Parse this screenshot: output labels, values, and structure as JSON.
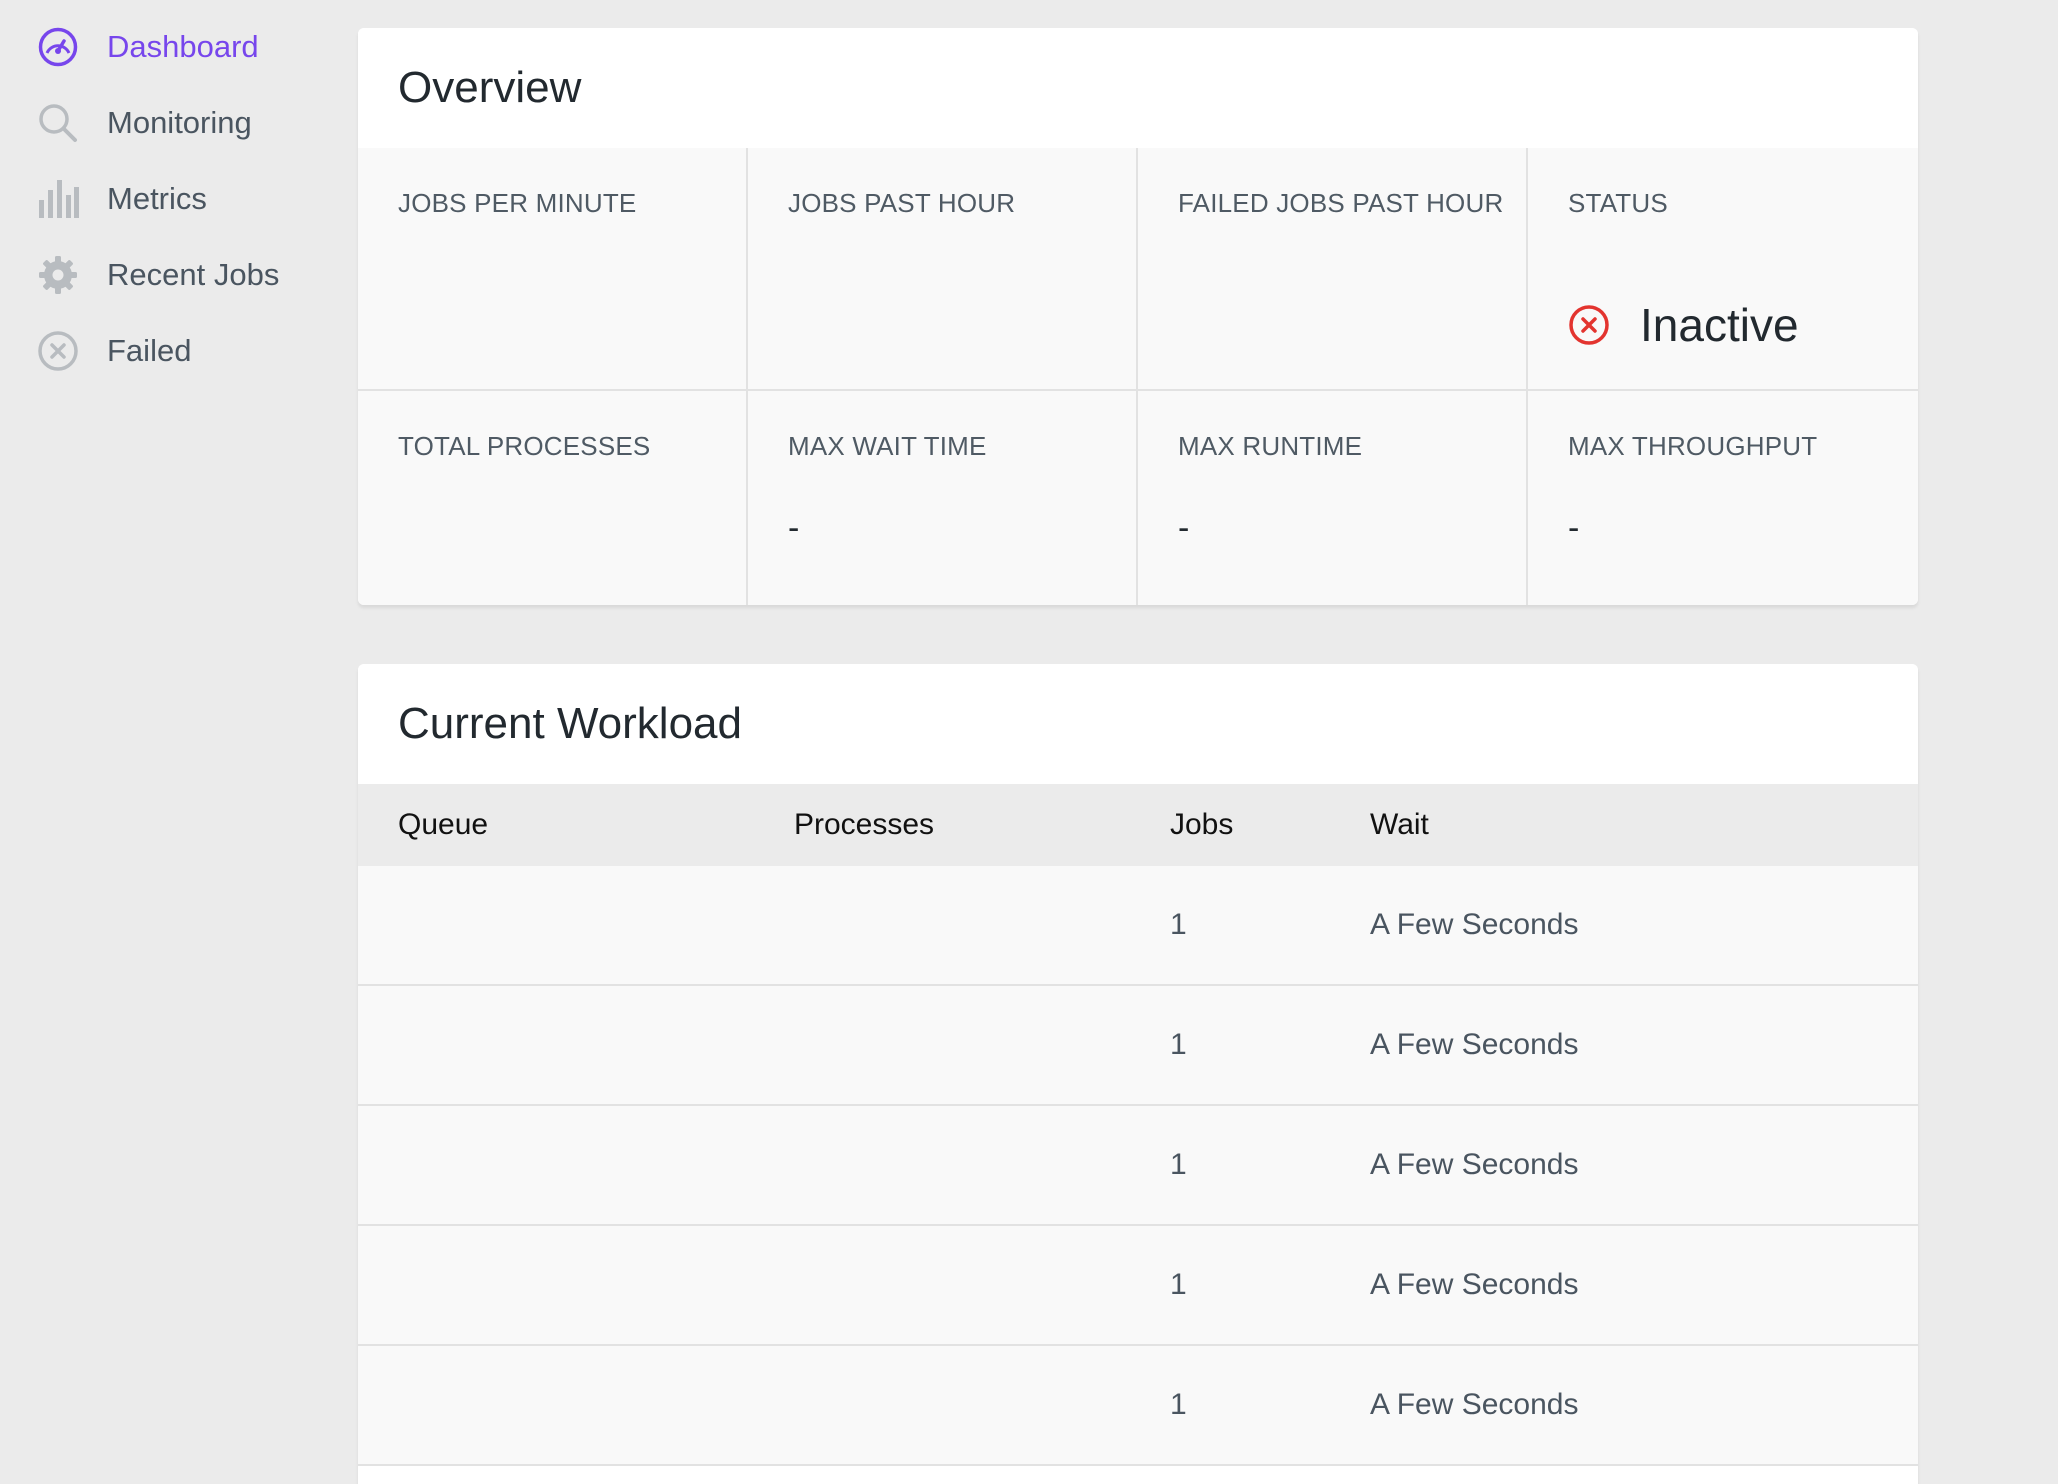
{
  "sidebar": {
    "items": [
      {
        "label": "Dashboard",
        "icon": "dashboard-gauge-icon",
        "active": true
      },
      {
        "label": "Monitoring",
        "icon": "search-icon",
        "active": false
      },
      {
        "label": "Metrics",
        "icon": "bar-chart-icon",
        "active": false
      },
      {
        "label": "Recent Jobs",
        "icon": "gear-icon",
        "active": false
      },
      {
        "label": "Failed",
        "icon": "x-circle-icon",
        "active": false
      }
    ]
  },
  "overview": {
    "title": "Overview",
    "stats": {
      "jobs_per_minute": {
        "label": "JOBS PER MINUTE",
        "value": ""
      },
      "jobs_past_hour": {
        "label": "JOBS PAST HOUR",
        "value": ""
      },
      "failed_jobs_past_hour": {
        "label": "FAILED JOBS PAST HOUR",
        "value": ""
      },
      "status": {
        "label": "STATUS",
        "value": "Inactive",
        "icon": "x-circle-icon",
        "color": "#e3342f"
      },
      "total_processes": {
        "label": "TOTAL PROCESSES",
        "value": ""
      },
      "max_wait_time": {
        "label": "MAX WAIT TIME",
        "value": "-"
      },
      "max_runtime": {
        "label": "MAX RUNTIME",
        "value": "-"
      },
      "max_throughput": {
        "label": "MAX THROUGHPUT",
        "value": "-"
      }
    }
  },
  "workload": {
    "title": "Current Workload",
    "columns": {
      "queue": "Queue",
      "processes": "Processes",
      "jobs": "Jobs",
      "wait": "Wait"
    },
    "rows": [
      {
        "queue": "",
        "processes": "",
        "jobs": "1",
        "wait": "A Few Seconds"
      },
      {
        "queue": "",
        "processes": "",
        "jobs": "1",
        "wait": "A Few Seconds"
      },
      {
        "queue": "",
        "processes": "",
        "jobs": "1",
        "wait": "A Few Seconds"
      },
      {
        "queue": "",
        "processes": "",
        "jobs": "1",
        "wait": "A Few Seconds"
      },
      {
        "queue": "",
        "processes": "",
        "jobs": "1",
        "wait": "A Few Seconds"
      }
    ]
  },
  "colors": {
    "accent": "#7746ec",
    "background": "#ebebeb",
    "icon_gray": "#b8bcc0",
    "danger": "#e3342f"
  }
}
